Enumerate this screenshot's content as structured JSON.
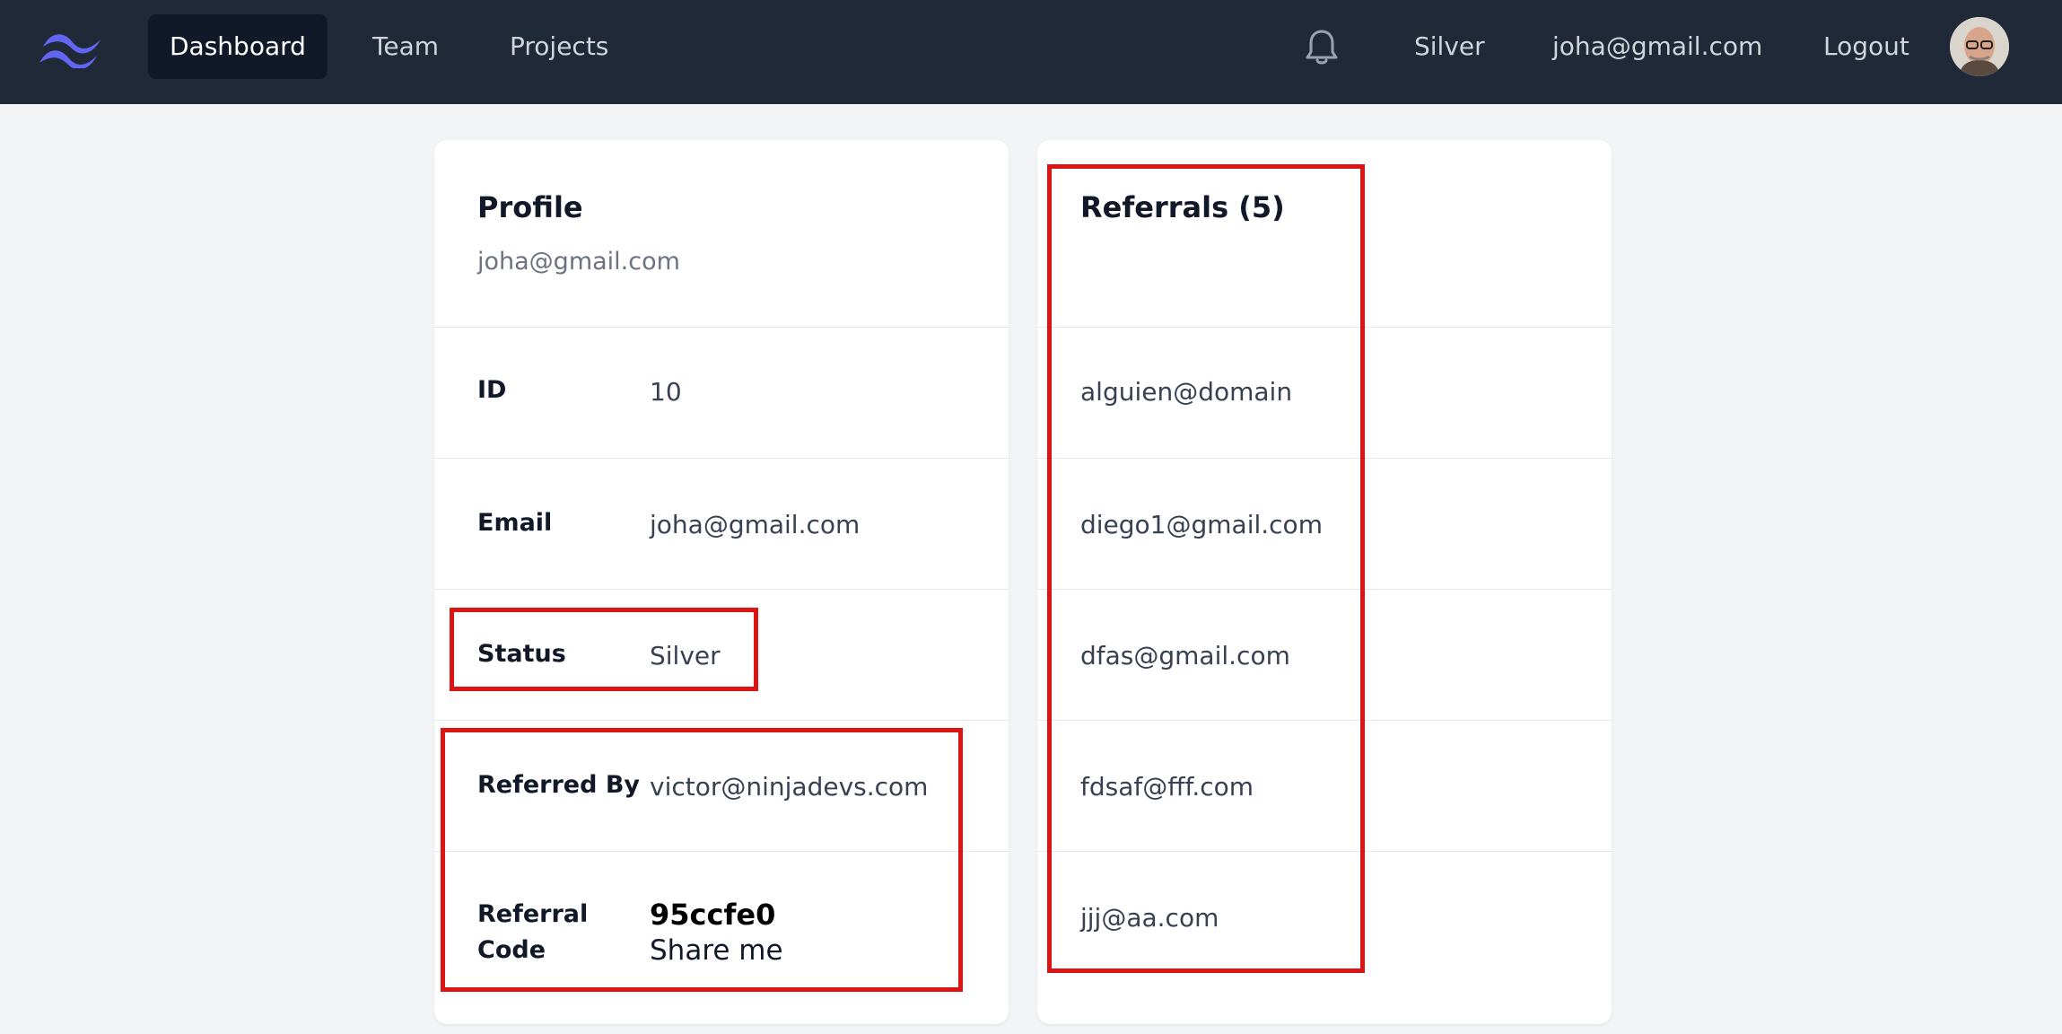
{
  "nav": {
    "links": [
      {
        "label": "Dashboard",
        "active": true
      },
      {
        "label": "Team",
        "active": false
      },
      {
        "label": "Projects",
        "active": false
      }
    ],
    "status": "Silver",
    "email": "joha@gmail.com",
    "logout": "Logout",
    "icons": {
      "logo": "tailwind-logo-icon",
      "notifications": "bell-icon"
    }
  },
  "profile": {
    "title": "Profile",
    "subtitle": "joha@gmail.com",
    "fields": {
      "id": {
        "label": "ID",
        "value": "10"
      },
      "email": {
        "label": "Email",
        "value": "joha@gmail.com"
      },
      "status": {
        "label": "Status",
        "value": "Silver"
      },
      "referred_by": {
        "label": "Referred By",
        "value": "victor@ninjadevs.com"
      },
      "referral_code": {
        "label_line1": "Referral",
        "label_line2": "Code",
        "code": "95ccfe0",
        "hint": "Share me"
      }
    }
  },
  "referrals": {
    "title": "Referrals (5)",
    "items": [
      "alguien@domain",
      "diego1@gmail.com",
      "dfas@gmail.com",
      "fdsaf@fff.com",
      "jjj@aa.com"
    ]
  },
  "colors": {
    "nav_bg": "#1f2937",
    "accent": "#6366f1",
    "annotation": "#dc1414"
  }
}
